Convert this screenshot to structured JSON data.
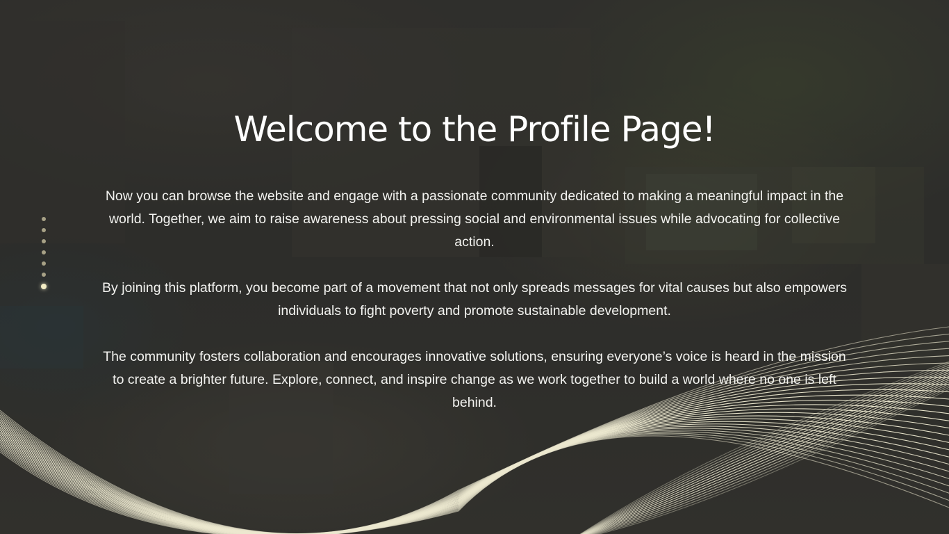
{
  "hero": {
    "title": "Welcome to the Profile Page!",
    "paragraphs": [
      "Now you can browse the website and engage with a passionate community dedicated to making a meaningful impact in the world. Together, we aim to raise awareness about pressing social and environmental issues while advocating for collective action.",
      "By joining this platform, you become part of a movement that not only spreads messages for vital causes but also empowers individuals to fight poverty and promote sustainable development.",
      "The community fosters collaboration and encourages innovative solutions, ensuring everyone’s voice is heard in the mission to create a brighter future. Explore, connect, and inspire change as we work together to build a world where no one is left behind."
    ]
  },
  "slide_indicator": {
    "count": 7,
    "active_index": 6
  },
  "colors": {
    "background": "#30302d",
    "wave": "#ece8cf",
    "text": "#ffffff",
    "dot": "#a7a186",
    "dot_active": "#f3ecc4"
  }
}
